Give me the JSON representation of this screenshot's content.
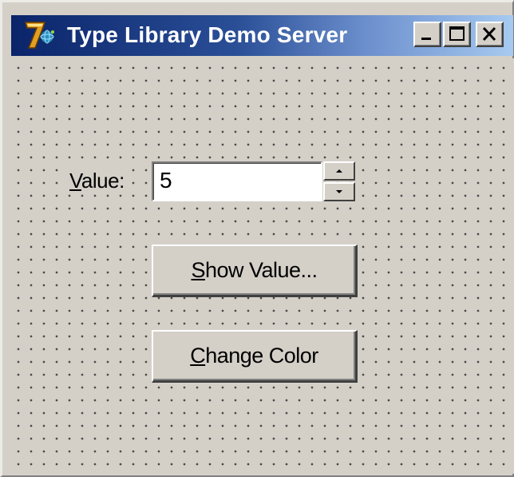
{
  "window": {
    "title": "Type Library Demo Server",
    "app_icon": "delphi-7-icon",
    "controls": {
      "minimize_icon": "minimize-icon",
      "maximize_icon": "maximize-icon",
      "close_icon": "close-icon"
    }
  },
  "form": {
    "value_label_mnemonic": "V",
    "value_label_rest": "alue:",
    "value_input": "5",
    "spin_up_icon": "arrow-up-icon",
    "spin_down_icon": "arrow-down-icon",
    "show_button_mnemonic": "S",
    "show_button_rest": "how Value...",
    "color_button_mnemonic": "C",
    "color_button_rest": "hange Color"
  },
  "colors": {
    "face": "#d4d0c8",
    "title_start": "#0a246a",
    "title_end": "#a6caf0"
  }
}
